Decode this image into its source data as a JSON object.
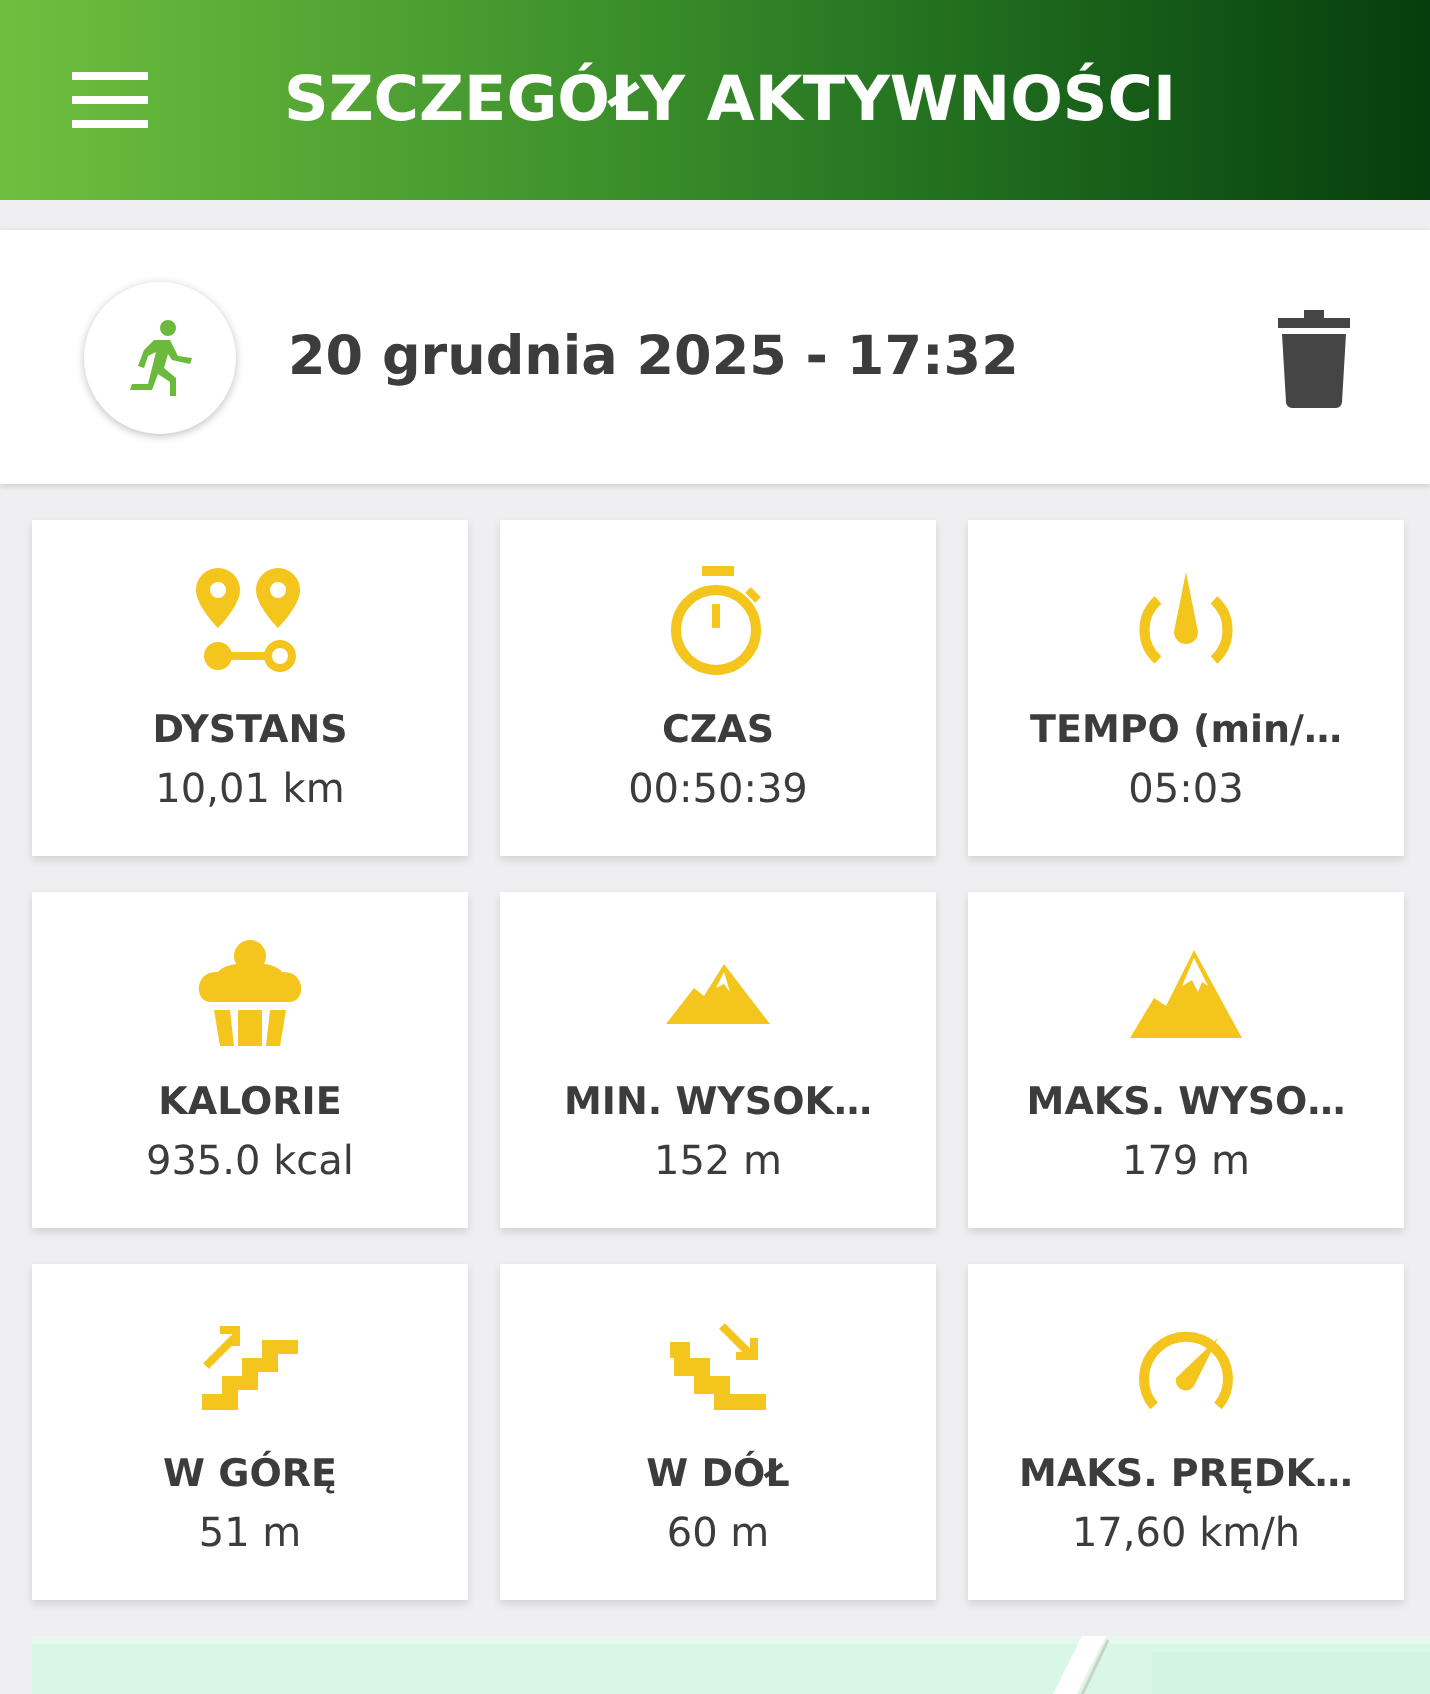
{
  "app_bar": {
    "title": "SZCZEGÓŁY AKTYWNOŚCI"
  },
  "activity": {
    "date": "20 grudnia 2025 - 17:32"
  },
  "stats": [
    {
      "label": "DYSTANS",
      "value": "10,01 km"
    },
    {
      "label": "CZAS",
      "value": "00:50:39"
    },
    {
      "label": "TEMPO (min/…",
      "value": "05:03"
    },
    {
      "label": "KALORIE",
      "value": "935.0 kcal"
    },
    {
      "label": "MIN. WYSOK…",
      "value": "152 m"
    },
    {
      "label": "MAKS. WYSO…",
      "value": "179 m"
    },
    {
      "label": "W GÓRĘ",
      "value": "51 m"
    },
    {
      "label": "W DÓŁ",
      "value": "60 m"
    },
    {
      "label": "MAKS. PRĘDK…",
      "value": "17,60 km/h"
    }
  ]
}
